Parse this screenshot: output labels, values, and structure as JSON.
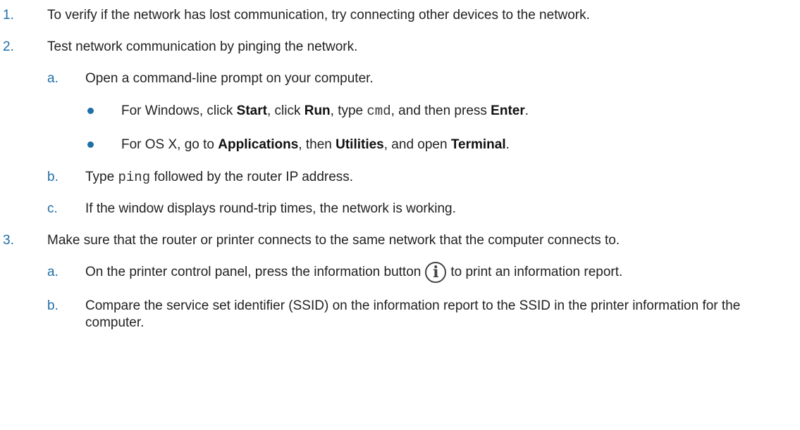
{
  "steps": [
    {
      "number": "1.",
      "text": "To verify if the network has lost communication, try connecting other devices to the network."
    },
    {
      "number": "2.",
      "text": "Test network communication by pinging the network.",
      "substeps": [
        {
          "letter": "a.",
          "text": "Open a command-line prompt on your computer.",
          "bullets": [
            {
              "p1": "For Windows, click ",
              "b1": "Start",
              "p2": ", click ",
              "b2": "Run",
              "p3": ", type ",
              "code": "cmd",
              "p4": ", and then press ",
              "b3": "Enter",
              "p5": "."
            },
            {
              "p1": "For OS X, go to ",
              "b1": "Applications",
              "p2": ", then ",
              "b2": "Utilities",
              "p3": ", and open ",
              "b3": "Terminal",
              "p4": "."
            }
          ]
        },
        {
          "letter": "b.",
          "p1": "Type ",
          "code": "ping",
          "p2": " followed by the router IP address."
        },
        {
          "letter": "c.",
          "text": "If the window displays round-trip times, the network is working."
        }
      ]
    },
    {
      "number": "3.",
      "text": "Make sure that the router or printer connects to the same network that the computer connects to.",
      "substeps": [
        {
          "letter": "a.",
          "p1": "On the printer control panel, press the information button",
          "icon": "info-icon",
          "icon_glyph": "i",
          "p2": "to print an information report."
        },
        {
          "letter": "b.",
          "text": "Compare the service set identifier (SSID) on the information report to the SSID in the printer information for the computer."
        }
      ]
    }
  ],
  "accent_color": "#1f6fa8"
}
